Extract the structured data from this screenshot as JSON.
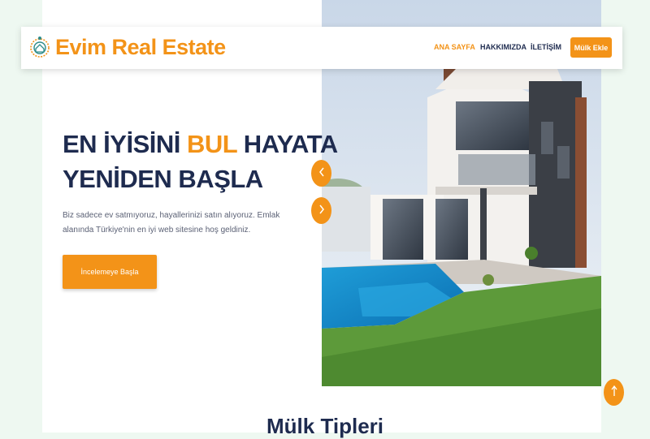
{
  "brand": {
    "name": "Evim Real Estate",
    "accent": "#f39318",
    "dark": "#1e2b4f"
  },
  "nav": {
    "items": [
      {
        "label": "ANA SAYFA",
        "active": true
      },
      {
        "label": "HAKKIMIZDA",
        "active": false
      },
      {
        "label": "İLETİŞİM",
        "active": false
      }
    ],
    "add_button": "Mülk Ekle"
  },
  "hero": {
    "title_part1": "EN İYİSİNİ ",
    "title_highlight": "BUL",
    "title_part2": " HAYATA",
    "title_line2": "YENİDEN BAŞLA",
    "description": "Biz sadece ev satmıyoruz, hayallerinizi satın alıyoruz. Emlak alanında Türkiye'nin en iyi web sitesine hoş geldiniz.",
    "cta": "İncelemeye Başla"
  },
  "icons": {
    "logo": "logo-emblem-icon",
    "prev": "chevron-left-icon",
    "next": "chevron-right-icon",
    "scroll_top": "arrow-up-icon"
  },
  "section": {
    "title": "Mülk Tipleri"
  }
}
